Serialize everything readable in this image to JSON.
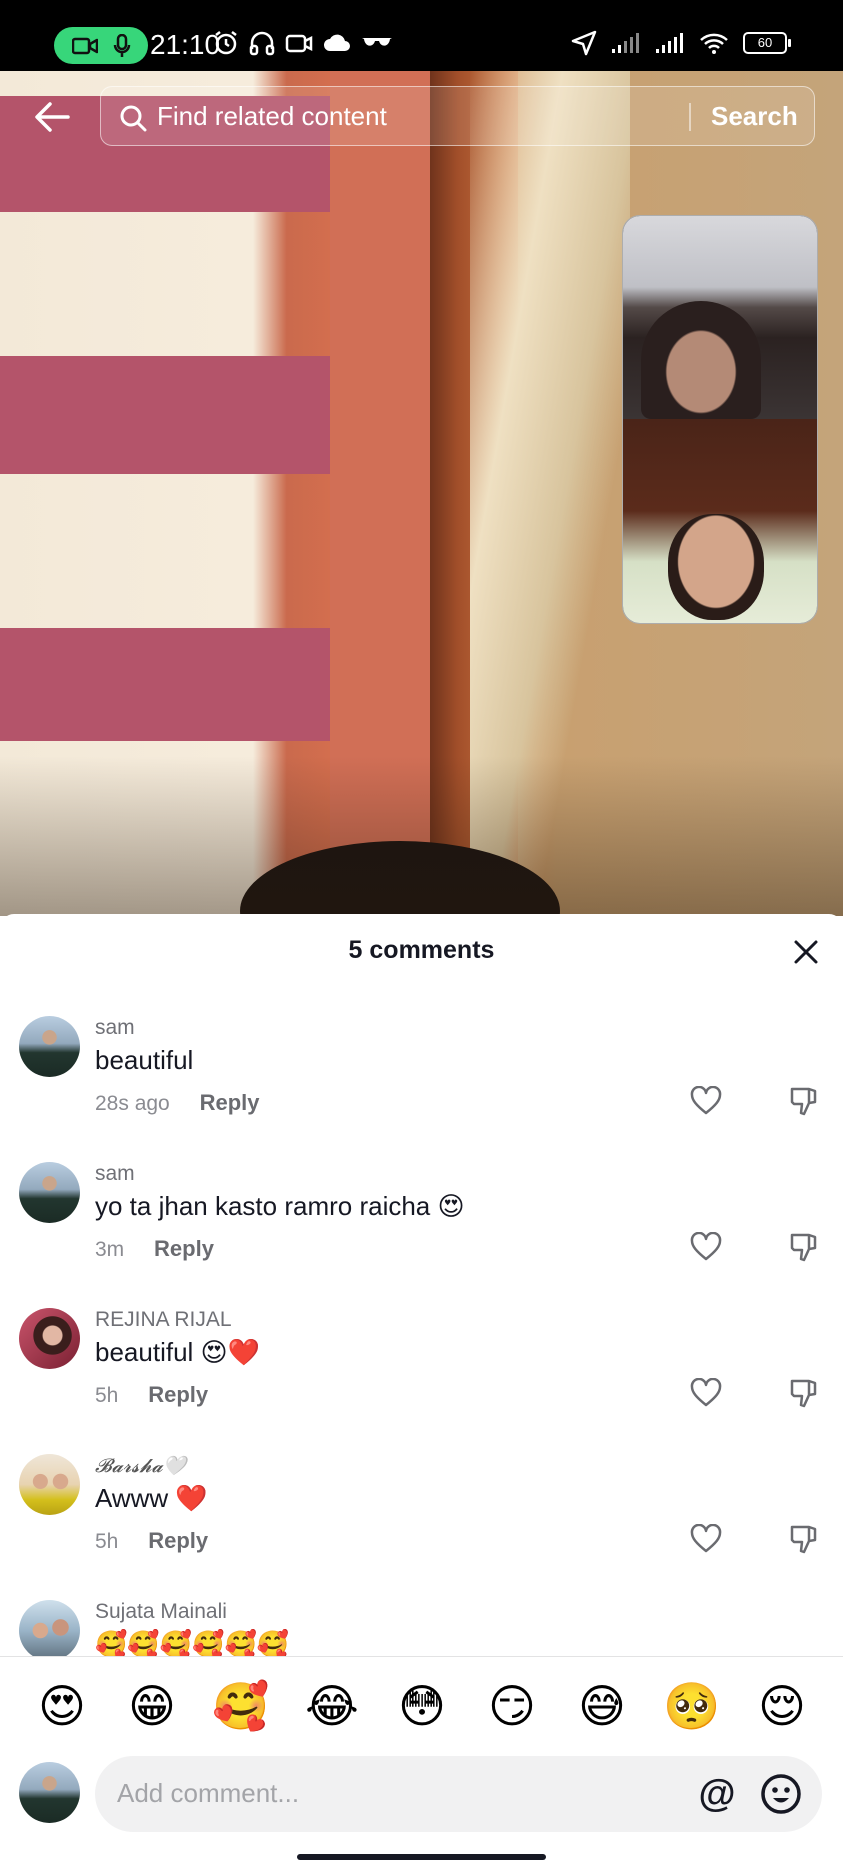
{
  "status_bar": {
    "time": "21:10",
    "battery": "60",
    "icons": [
      "camera-icon",
      "mic-icon",
      "alarm-icon",
      "headphones-icon",
      "video-icon",
      "cloud-icon",
      "glasses-icon",
      "location-icon",
      "signal-icon",
      "signal-icon",
      "wifi-icon",
      "battery-icon"
    ]
  },
  "top_bar": {
    "search_placeholder": "Find related content",
    "search_button": "Search"
  },
  "comments": {
    "title": "5 comments",
    "items": [
      {
        "user": "sam",
        "text": "beautiful",
        "time": "28s ago",
        "reply": "Reply"
      },
      {
        "user": "sam",
        "text": "yo ta jhan kasto ramro raicha 😍",
        "time": "3m",
        "reply": "Reply"
      },
      {
        "user": "REJINA RIJAL",
        "text": "beautiful 😍❤️",
        "time": "5h",
        "reply": "Reply"
      },
      {
        "user": "𝓑𝓪𝓻𝓼𝓱𝓪🤍",
        "text": "Awww ❤️",
        "time": "5h",
        "reply": "Reply"
      },
      {
        "user": "Sujata Mainali",
        "text": "🥰🥰🥰🥰🥰🥰",
        "time": "",
        "reply": ""
      }
    ]
  },
  "emoji_bar": [
    "😍",
    "😁",
    "🥰",
    "😂",
    "😳",
    "😏",
    "😅",
    "🥺",
    "😌"
  ],
  "composer": {
    "placeholder": "Add comment...",
    "at_symbol": "@"
  }
}
